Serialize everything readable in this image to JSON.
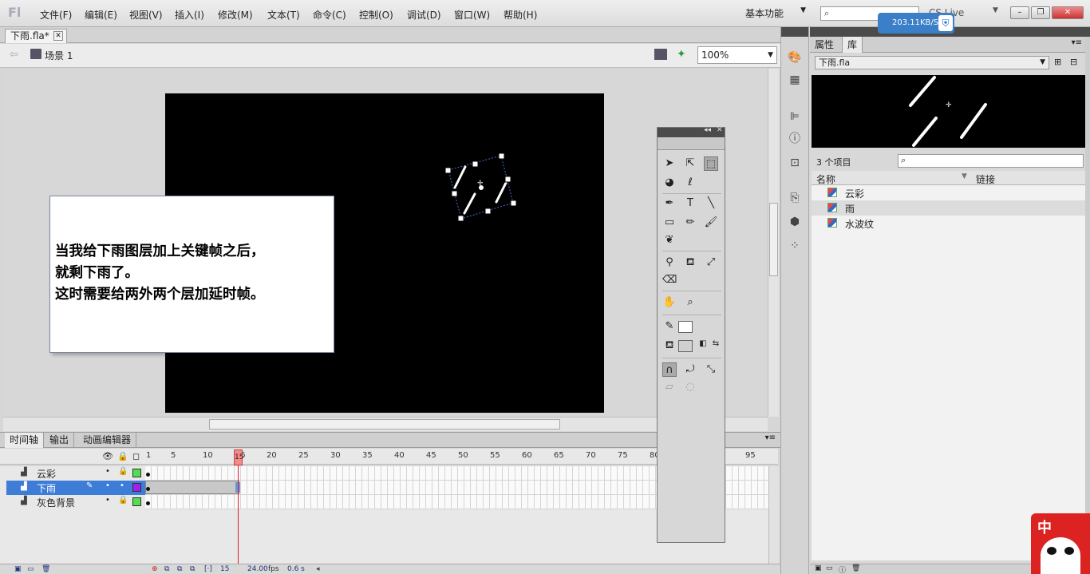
{
  "app": {
    "logo": "Fl",
    "workspace": "基本功能",
    "cs_live": "CS Live",
    "net_speed": "203.11KB/S"
  },
  "menu": [
    "文件(F)",
    "编辑(E)",
    "视图(V)",
    "插入(I)",
    "修改(M)",
    "文本(T)",
    "命令(C)",
    "控制(O)",
    "调试(D)",
    "窗口(W)",
    "帮助(H)"
  ],
  "document": {
    "tab_title": "下雨.fla*",
    "scene": "场景 1",
    "zoom": "100%"
  },
  "caption": {
    "lines": [
      "当我给下雨图层加上关键帧之后，",
      "就剩下雨了。",
      "这时需要给两外两个层加延时帧。"
    ]
  },
  "timeline": {
    "tabs": [
      "时间轴",
      "输出",
      "动画编辑器"
    ],
    "active_tab": "时间轴",
    "frame_numbers": [
      "1",
      "5",
      "10",
      "15",
      "20",
      "25",
      "30",
      "35",
      "40",
      "45",
      "50",
      "55",
      "60",
      "65",
      "70",
      "75",
      "80",
      "95"
    ],
    "current_frame": "15",
    "layers": [
      {
        "name": "云彩",
        "color": "#4fe04f",
        "locked": true,
        "selected": false
      },
      {
        "name": "下雨",
        "color": "#a020f0",
        "locked": false,
        "selected": true
      },
      {
        "name": "灰色背景",
        "color": "#4fe04f",
        "locked": true,
        "selected": false
      }
    ],
    "footer": {
      "frame": "15",
      "fps": "24.00",
      "fps_unit": "fps",
      "time": "0.6 s"
    }
  },
  "library": {
    "tabs": [
      "属性",
      "库"
    ],
    "active_tab": "库",
    "file": "下雨.fla",
    "count": "3 个项目",
    "columns": {
      "name": "名称",
      "linkage": "链接"
    },
    "items": [
      {
        "name": "云彩",
        "selected": false
      },
      {
        "name": "雨",
        "selected": true
      },
      {
        "name": "水波纹",
        "selected": false
      }
    ]
  },
  "panda_badge": "中"
}
